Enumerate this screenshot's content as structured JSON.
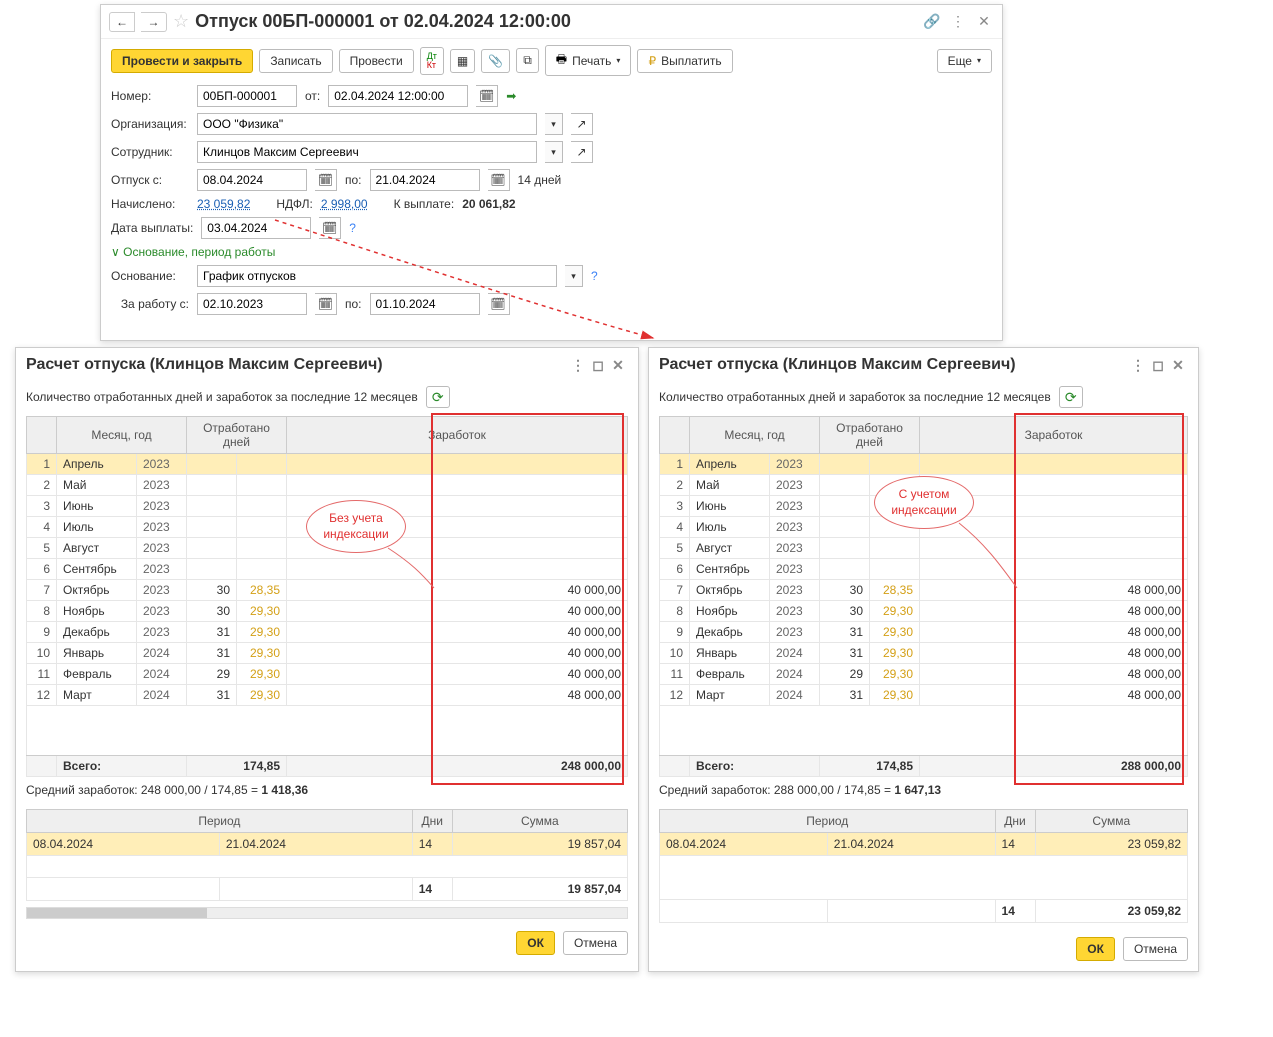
{
  "top": {
    "title": "Отпуск 00БП-000001 от 02.04.2024 12:00:00",
    "btn_post_close": "Провести и закрыть",
    "btn_write": "Записать",
    "btn_post": "Провести",
    "btn_print": "Печать",
    "btn_pay": "Выплатить",
    "btn_more": "Еще",
    "lbl_number": "Номер:",
    "number": "00БП-000001",
    "lbl_from": "от:",
    "date": "02.04.2024 12:00:00",
    "lbl_org": "Организация:",
    "org": "ООО \"Физика\"",
    "lbl_emp": "Сотрудник:",
    "emp": "Клинцов Максим Сергеевич",
    "lbl_vac_from": "Отпуск с:",
    "vac_from": "08.04.2024",
    "lbl_to": "по:",
    "vac_to": "21.04.2024",
    "days_text": "14 дней",
    "lbl_accrued": "Начислено:",
    "accrued": "23 059,82",
    "lbl_ndfl": "НДФЛ:",
    "ndfl": "2 998,00",
    "lbl_topay": "К выплате:",
    "topay": "20 061,82",
    "lbl_paydate": "Дата выплаты:",
    "paydate": "03.04.2024",
    "link_expand": "Основание, период работы",
    "lbl_basis": "Основание:",
    "basis": "График отпусков",
    "lbl_work_from": "За работу с:",
    "work_from": "02.10.2023",
    "work_to": "01.10.2024"
  },
  "calc": {
    "title_prefix": "Расчет отпуска (",
    "title_emp": "Клинцов Максим Сергеевич",
    "title_suffix": ")",
    "subtitle": "Количество отработанных дней и заработок за последние 12 месяцев",
    "col_month": "Месяц, год",
    "col_days": "Отработано дней",
    "col_earn": "Заработок",
    "rows_left": [
      {
        "n": 1,
        "m": "Апрель",
        "y": "2023"
      },
      {
        "n": 2,
        "m": "Май",
        "y": "2023"
      },
      {
        "n": 3,
        "m": "Июнь",
        "y": "2023"
      },
      {
        "n": 4,
        "m": "Июль",
        "y": "2023"
      },
      {
        "n": 5,
        "m": "Август",
        "y": "2023"
      },
      {
        "n": 6,
        "m": "Сентябрь",
        "y": "2023"
      },
      {
        "n": 7,
        "m": "Октябрь",
        "y": "2023",
        "d": "30",
        "c": "28,35",
        "e": "40 000,00"
      },
      {
        "n": 8,
        "m": "Ноябрь",
        "y": "2023",
        "d": "30",
        "c": "29,30",
        "e": "40 000,00"
      },
      {
        "n": 9,
        "m": "Декабрь",
        "y": "2023",
        "d": "31",
        "c": "29,30",
        "e": "40 000,00"
      },
      {
        "n": 10,
        "m": "Январь",
        "y": "2024",
        "d": "31",
        "c": "29,30",
        "e": "40 000,00"
      },
      {
        "n": 11,
        "m": "Февраль",
        "y": "2024",
        "d": "29",
        "c": "29,30",
        "e": "40 000,00"
      },
      {
        "n": 12,
        "m": "Март",
        "y": "2024",
        "d": "31",
        "c": "29,30",
        "e": "48 000,00"
      }
    ],
    "rows_right": [
      {
        "n": 1,
        "m": "Апрель",
        "y": "2023"
      },
      {
        "n": 2,
        "m": "Май",
        "y": "2023"
      },
      {
        "n": 3,
        "m": "Июнь",
        "y": "2023"
      },
      {
        "n": 4,
        "m": "Июль",
        "y": "2023"
      },
      {
        "n": 5,
        "m": "Август",
        "y": "2023"
      },
      {
        "n": 6,
        "m": "Сентябрь",
        "y": "2023"
      },
      {
        "n": 7,
        "m": "Октябрь",
        "y": "2023",
        "d": "30",
        "c": "28,35",
        "e": "48 000,00"
      },
      {
        "n": 8,
        "m": "Ноябрь",
        "y": "2023",
        "d": "30",
        "c": "29,30",
        "e": "48 000,00"
      },
      {
        "n": 9,
        "m": "Декабрь",
        "y": "2023",
        "d": "31",
        "c": "29,30",
        "e": "48 000,00"
      },
      {
        "n": 10,
        "m": "Январь",
        "y": "2024",
        "d": "31",
        "c": "29,30",
        "e": "48 000,00"
      },
      {
        "n": 11,
        "m": "Февраль",
        "y": "2024",
        "d": "29",
        "c": "29,30",
        "e": "48 000,00"
      },
      {
        "n": 12,
        "m": "Март",
        "y": "2024",
        "d": "31",
        "c": "29,30",
        "e": "48 000,00"
      }
    ],
    "total_lbl": "Всего:",
    "total_days": "174,85",
    "total_earn_left": "248 000,00",
    "total_earn_right": "288 000,00",
    "avg_left_prefix": "Средний заработок: 248 000,00 / 174,85 = ",
    "avg_left_val": "1 418,36",
    "avg_right_prefix": "Средний заработок: 288 000,00 / 174,85 = ",
    "avg_right_val": "1 647,13",
    "p_col_period": "Период",
    "p_col_days": "Дни",
    "p_col_sum": "Сумма",
    "p_from": "08.04.2024",
    "p_to": "21.04.2024",
    "p_days": "14",
    "p_sum_left": "19 857,04",
    "p_sum_right": "23 059,82",
    "p_tot_days": "14",
    "p_tot_left": "19 857,04",
    "p_tot_right": "23 059,82",
    "btn_ok": "ОК",
    "btn_cancel": "Отмена",
    "callout_left_l1": "Без учета",
    "callout_left_l2": "индексации",
    "callout_right_l1": "С учетом",
    "callout_right_l2": "индексации"
  }
}
